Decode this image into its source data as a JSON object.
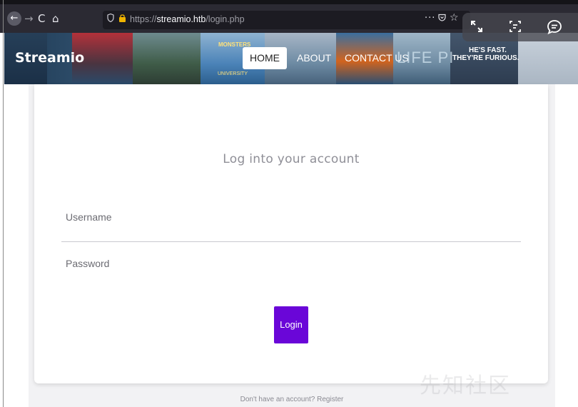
{
  "browser": {
    "url_scheme": "https://",
    "url_domain": "streamio.htb",
    "url_path": "/login.php",
    "nav": {
      "back_icon": "←",
      "forward_icon": "→",
      "reload_icon": "C",
      "home_icon": "⌂"
    },
    "actions": {
      "menu_icon": "···",
      "star_icon": "☆"
    }
  },
  "overlay": {
    "expand_icon": "⛶",
    "text_icon": "☰",
    "chat_icon": "💬"
  },
  "site": {
    "brand": "Streamio",
    "nav": {
      "home": "HOME",
      "about": "ABOUT",
      "contact": "CONTACT US"
    },
    "poster_texts": {
      "monsters": "MONSTERS",
      "university": "UNIVERSITY",
      "life_pi": "LIFE PI",
      "fast": "HE'S FAST.",
      "furious": "THEY'RE FURIOUS."
    }
  },
  "login": {
    "heading": "Log into your account",
    "username_label": "Username",
    "password_label": "Password",
    "submit_label": "Login"
  },
  "footer": {
    "register_prompt": "Don't have an account? Register"
  },
  "watermark": "先知社区"
}
